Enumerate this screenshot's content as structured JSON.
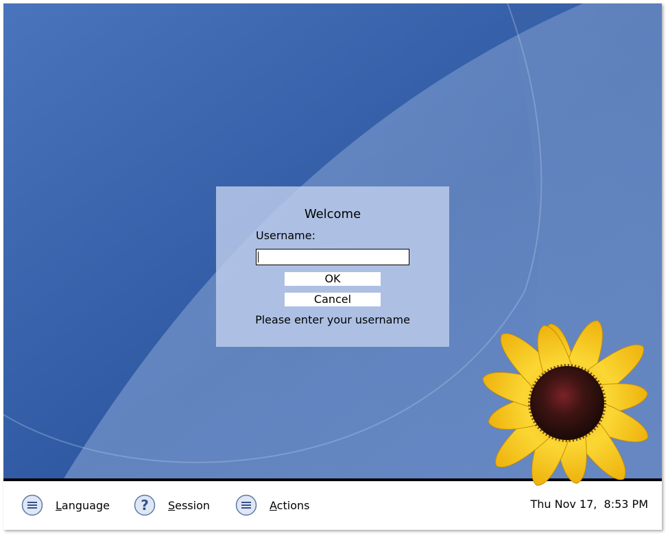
{
  "dialog": {
    "title": "Welcome",
    "username_label": "Username:",
    "username_value": "",
    "ok_label": "OK",
    "cancel_label": "Cancel",
    "message": "Please enter your username"
  },
  "bottom_bar": {
    "items": [
      {
        "label": "Language",
        "icon": "menu-icon"
      },
      {
        "label": "Session",
        "icon": "question-icon"
      },
      {
        "label": "Actions",
        "icon": "menu-icon"
      }
    ],
    "clock": "Thu Nov 17,  8:53 PM"
  },
  "colors": {
    "wallpaper_dark": "#2c55a0",
    "wallpaper_light": "#5a82c2",
    "dialog_bg": "#bccde9",
    "petal": "#f6c51a",
    "flower_center": "#3a1210"
  }
}
